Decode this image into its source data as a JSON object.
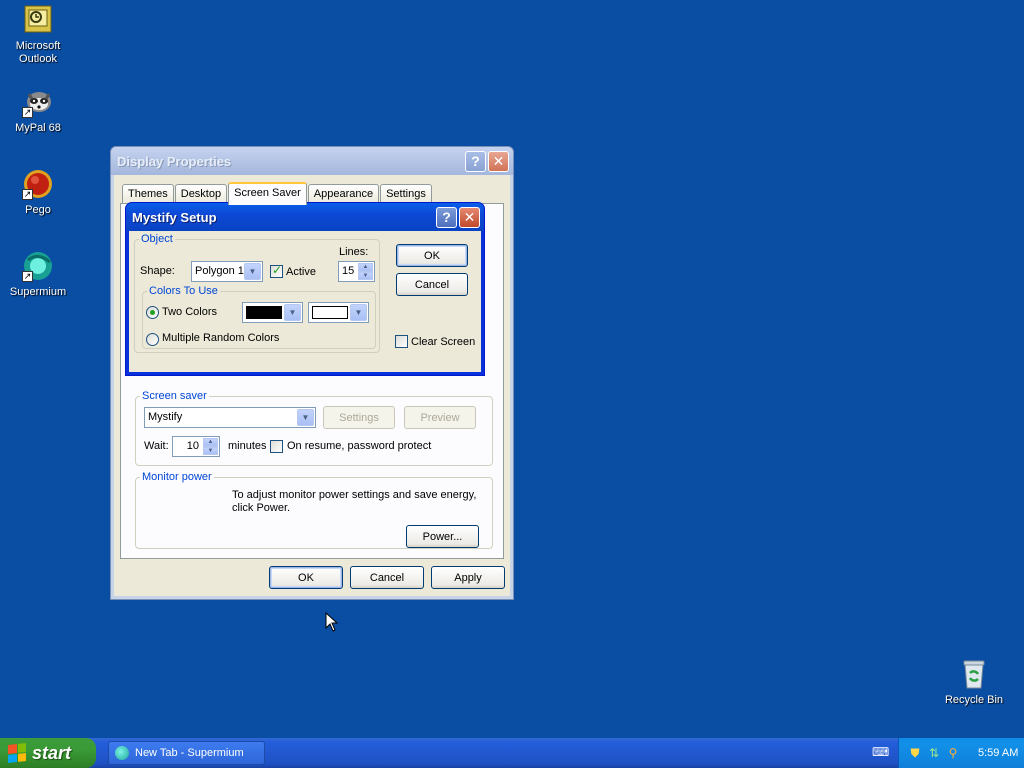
{
  "desktop": {
    "icons": [
      {
        "label": "Microsoft Outlook"
      },
      {
        "label": "MyPal 68"
      },
      {
        "label": "Pego"
      },
      {
        "label": "Supermium"
      },
      {
        "label": "Recycle Bin"
      }
    ]
  },
  "display_properties": {
    "title": "Display Properties",
    "help": "?",
    "close": "✕",
    "tabs": [
      {
        "label": "Themes"
      },
      {
        "label": "Desktop"
      },
      {
        "label": "Screen Saver",
        "active": true
      },
      {
        "label": "Appearance"
      },
      {
        "label": "Settings"
      }
    ],
    "screen_saver_group": {
      "legend": "Screen saver",
      "selected": "Mystify",
      "settings_label": "Settings",
      "preview_label": "Preview",
      "wait_label": "Wait:",
      "wait_value": "10",
      "minutes_label": "minutes",
      "password_label": "On resume, password protect",
      "password_checked": false
    },
    "monitor_power": {
      "legend": "Monitor power",
      "description": "To adjust monitor power settings and save energy, click Power.",
      "power_label": "Power..."
    },
    "ok_label": "OK",
    "cancel_label": "Cancel",
    "apply_label": "Apply"
  },
  "mystify_setup": {
    "title": "Mystify Setup",
    "help": "?",
    "close": "✕",
    "object_legend": "Object",
    "shape_label": "Shape:",
    "shape_value": "Polygon 1",
    "active_label": "Active",
    "active_checked": true,
    "lines_label": "Lines:",
    "lines_value": "15",
    "colors_legend": "Colors To Use",
    "two_colors_label": "Two Colors",
    "multiple_colors_label": "Multiple Random Colors",
    "selected_color_mode": "Two Colors",
    "color1": "#000000",
    "color2": "#ffffff",
    "ok_label": "OK",
    "cancel_label": "Cancel",
    "clear_screen_label": "Clear Screen",
    "clear_screen_checked": false
  },
  "taskbar": {
    "start_label": "start",
    "task_label": "New Tab - Supermium",
    "clock": "5:59 AM"
  },
  "colors": {
    "desktop_bg": "#0a4ea3",
    "active_title": "#0843c4",
    "start_green": "#3a9a36"
  }
}
